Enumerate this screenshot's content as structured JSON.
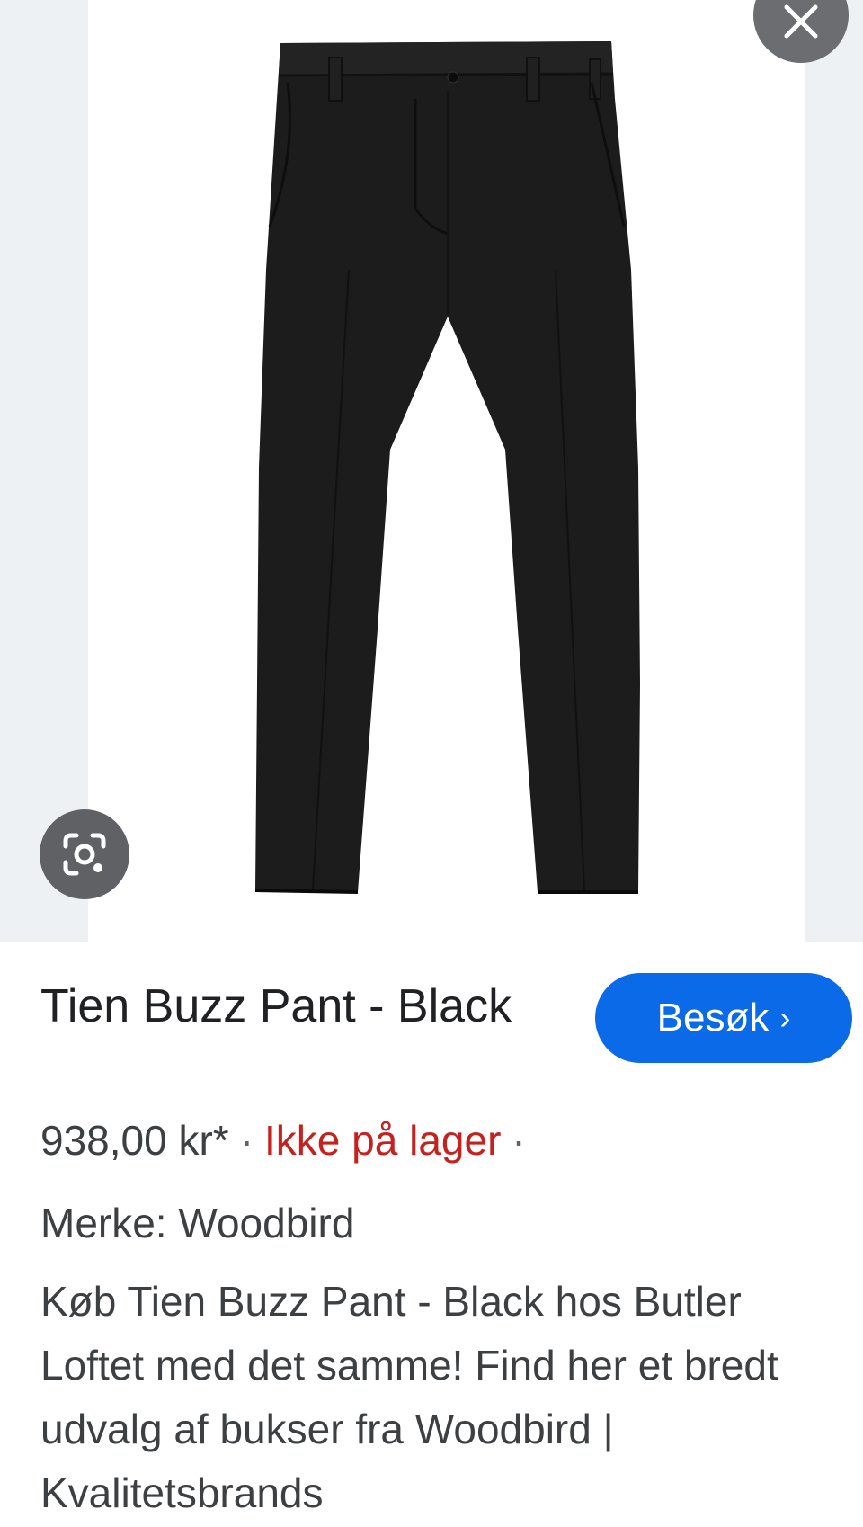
{
  "product": {
    "title": "Tien Buzz Pant - Black",
    "price": "938,00 kr*",
    "separator": "·",
    "stock_status": "Ikke på lager",
    "trailing_separator": "·",
    "brand_label": "Merke:",
    "brand_value": "Woodbird",
    "description": "Køb Tien Buzz Pant - Black hos Butler Loftet med det samme! Find her et bredt udvalg af bukser fra Woodbird | Kvalitetsbrands"
  },
  "actions": {
    "visit_label": "Besøk",
    "visit_chevron": "›"
  },
  "icons": {
    "close": "close-icon",
    "lens": "google-lens-icon",
    "chevron": "chevron-right-icon"
  },
  "colors": {
    "visit_button": "#0b6ae8",
    "stock_status": "#c5221f",
    "text": "#3c4043",
    "overlay_button": "#6b6d70"
  }
}
